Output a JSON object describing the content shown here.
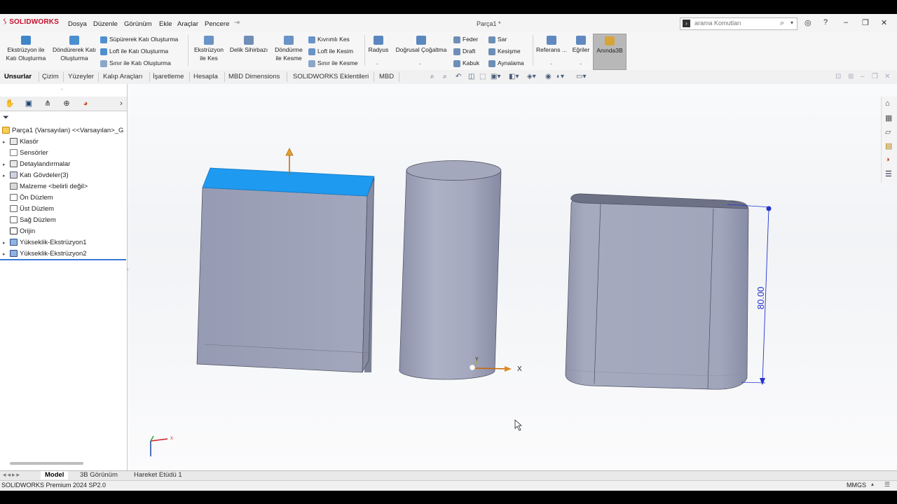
{
  "app": {
    "logo": "SOLIDWORKS",
    "doc_title": "Parça1 *"
  },
  "menu": [
    "Dosya",
    "Düzenle",
    "Görünüm",
    "Ekle",
    "Araçlar",
    "Pencere"
  ],
  "search": {
    "placeholder": "arama Komutları"
  },
  "ribbon": {
    "extrude_boss": "Ekstrüzyon ile Katı Oluşturma",
    "revolve_boss": "Döndürerek Katı Oluşturma",
    "swept_boss": "Süpürerek Katı Oluşturma",
    "loft_boss": "Loft ile Katı Oluşturma",
    "boundary_boss": "Sınır ile Katı Oluşturma",
    "extrude_cut": "Ekstrüzyon ile Kes",
    "hole_wizard": "Delik Sihirbazı",
    "revolve_cut": "Döndürme ile Kesme",
    "swept_cut": "Kıvrımlı Kes",
    "loft_cut": "Loft ile Kesim",
    "boundary_cut": "Sınır ile Kesme",
    "fillet": "Radyus",
    "linear_pattern": "Doğrusal Çoğaltma",
    "rib": "Feder",
    "draft": "Draft",
    "shell": "Kabuk",
    "wrap": "Sar",
    "intersect": "Kesişme",
    "mirror": "Aynalama",
    "reference": "Referans ...",
    "curves": "Eğriler",
    "instant3d": "Anında3B"
  },
  "tabs": [
    "Unsurlar",
    "Çizim",
    "Yüzeyler",
    "Kalıp Araçları",
    "İşaretleme",
    "Hesapla",
    "MBD Dimensions",
    "SOLIDWORKS Eklentileri",
    "MBD"
  ],
  "tree": {
    "root": "Parça1 (Varsayılan) <<Varsayılan>_G",
    "items": [
      {
        "label": "Klasör",
        "icon": "annotations-icon",
        "caret": true
      },
      {
        "label": "Sensörler",
        "icon": "sensor-icon",
        "caret": false
      },
      {
        "label": "Detaylandırmalar",
        "icon": "annotations-icon",
        "caret": true
      },
      {
        "label": "Katı Gövdeler(3)",
        "icon": "solid-bodies-icon",
        "caret": true
      },
      {
        "label": "Malzeme <belirli değil>",
        "icon": "material-icon",
        "caret": false
      },
      {
        "label": "Ön Düzlem",
        "icon": "plane-icon",
        "caret": false
      },
      {
        "label": "Üst Düzlem",
        "icon": "plane-icon",
        "caret": false
      },
      {
        "label": "Sağ Düzlem",
        "icon": "plane-icon",
        "caret": false
      },
      {
        "label": "Orijin",
        "icon": "origin-icon",
        "caret": false
      },
      {
        "label": "Yükseklik-Ekstrüzyon1",
        "icon": "extrude-icon",
        "caret": true
      },
      {
        "label": "Yükseklik-Ekstrüzyon2",
        "icon": "extrude-icon",
        "caret": true
      }
    ]
  },
  "viewport": {
    "dimension_value": "80.00",
    "triad_x": "X",
    "triad_y": "Y",
    "mini_triad_x": "X"
  },
  "bottom_tabs": [
    "Model",
    "3B Görünüm",
    "Hareket Etüdü 1"
  ],
  "status": {
    "product": "SOLIDWORKS Premium 2024 SP2.0",
    "units": "MMGS"
  },
  "colors": {
    "body": "#9ea3b9",
    "selected_face": "#1e9af0",
    "dimension": "#2233cc",
    "logo": "#c8102e"
  }
}
